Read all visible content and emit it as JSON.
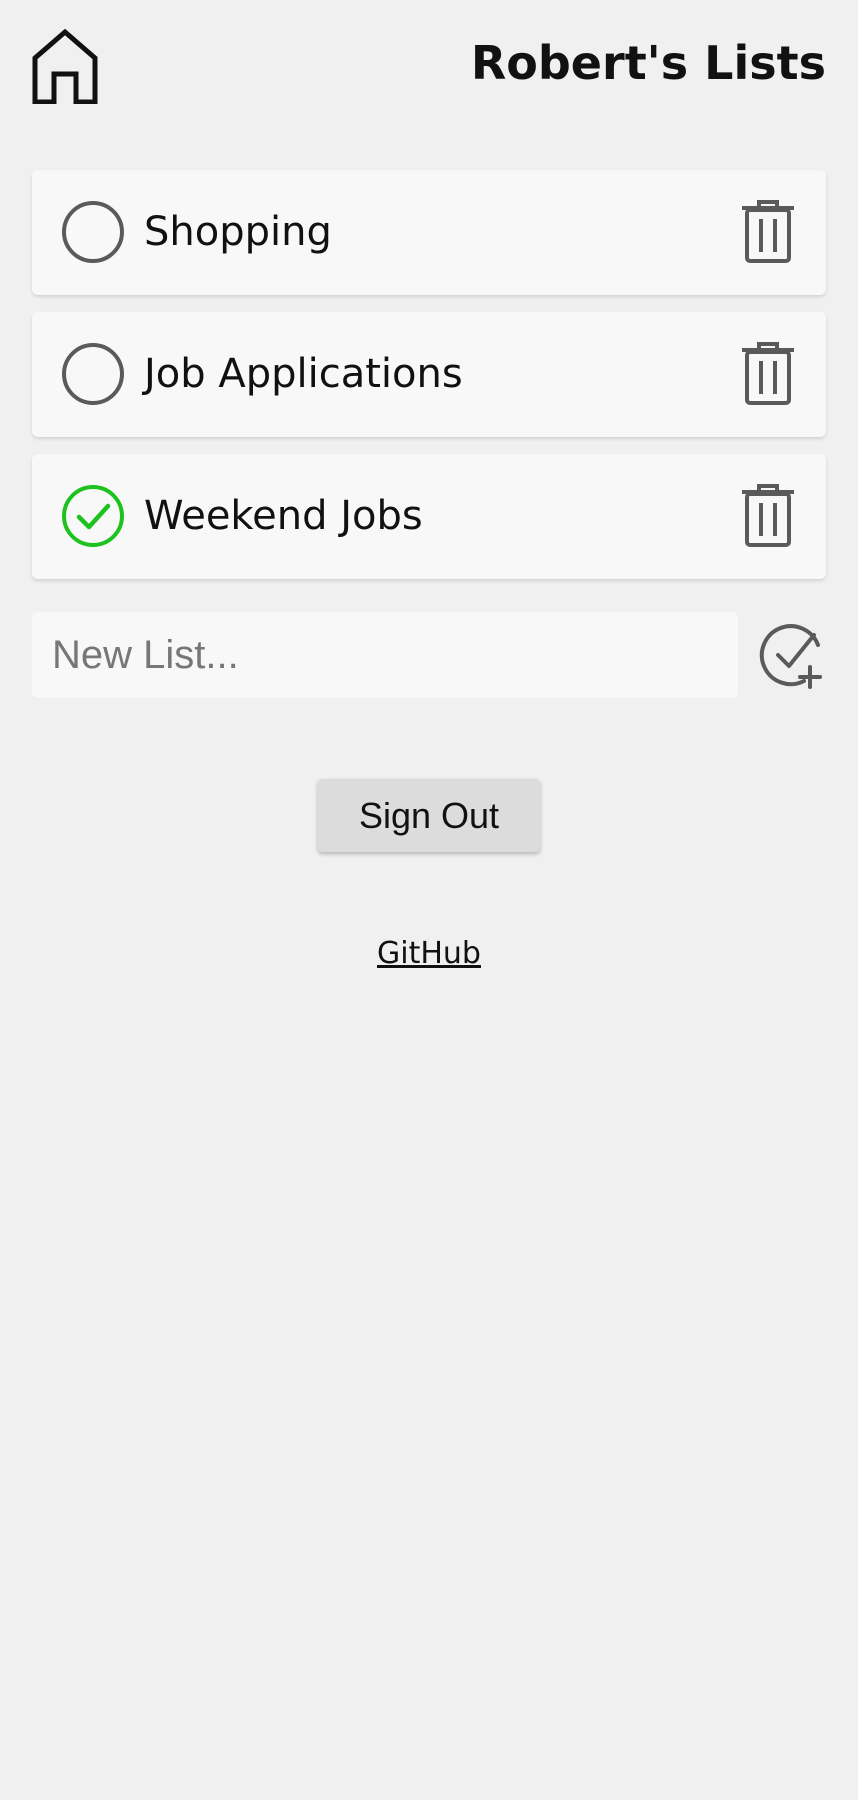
{
  "header": {
    "title": "Robert's Lists",
    "home_icon": "home-icon"
  },
  "lists": [
    {
      "name": "Shopping",
      "completed": false,
      "status_icon": "empty-circle-icon",
      "delete_icon": "trash-icon"
    },
    {
      "name": "Job Applications",
      "completed": false,
      "status_icon": "empty-circle-icon",
      "delete_icon": "trash-icon"
    },
    {
      "name": "Weekend Jobs",
      "completed": true,
      "status_icon": "check-circle-icon",
      "delete_icon": "trash-icon"
    }
  ],
  "new_list": {
    "placeholder": "New List...",
    "value": "",
    "add_icon": "check-circle-plus-icon"
  },
  "sign_out_label": "Sign Out",
  "footer": {
    "github_label": "GitHub"
  },
  "colors": {
    "background": "#f0f0f0",
    "card": "#f8f8f8",
    "icon_gray": "#5a5a5a",
    "check_green": "#1ec21e",
    "button": "#dcdcdc"
  }
}
